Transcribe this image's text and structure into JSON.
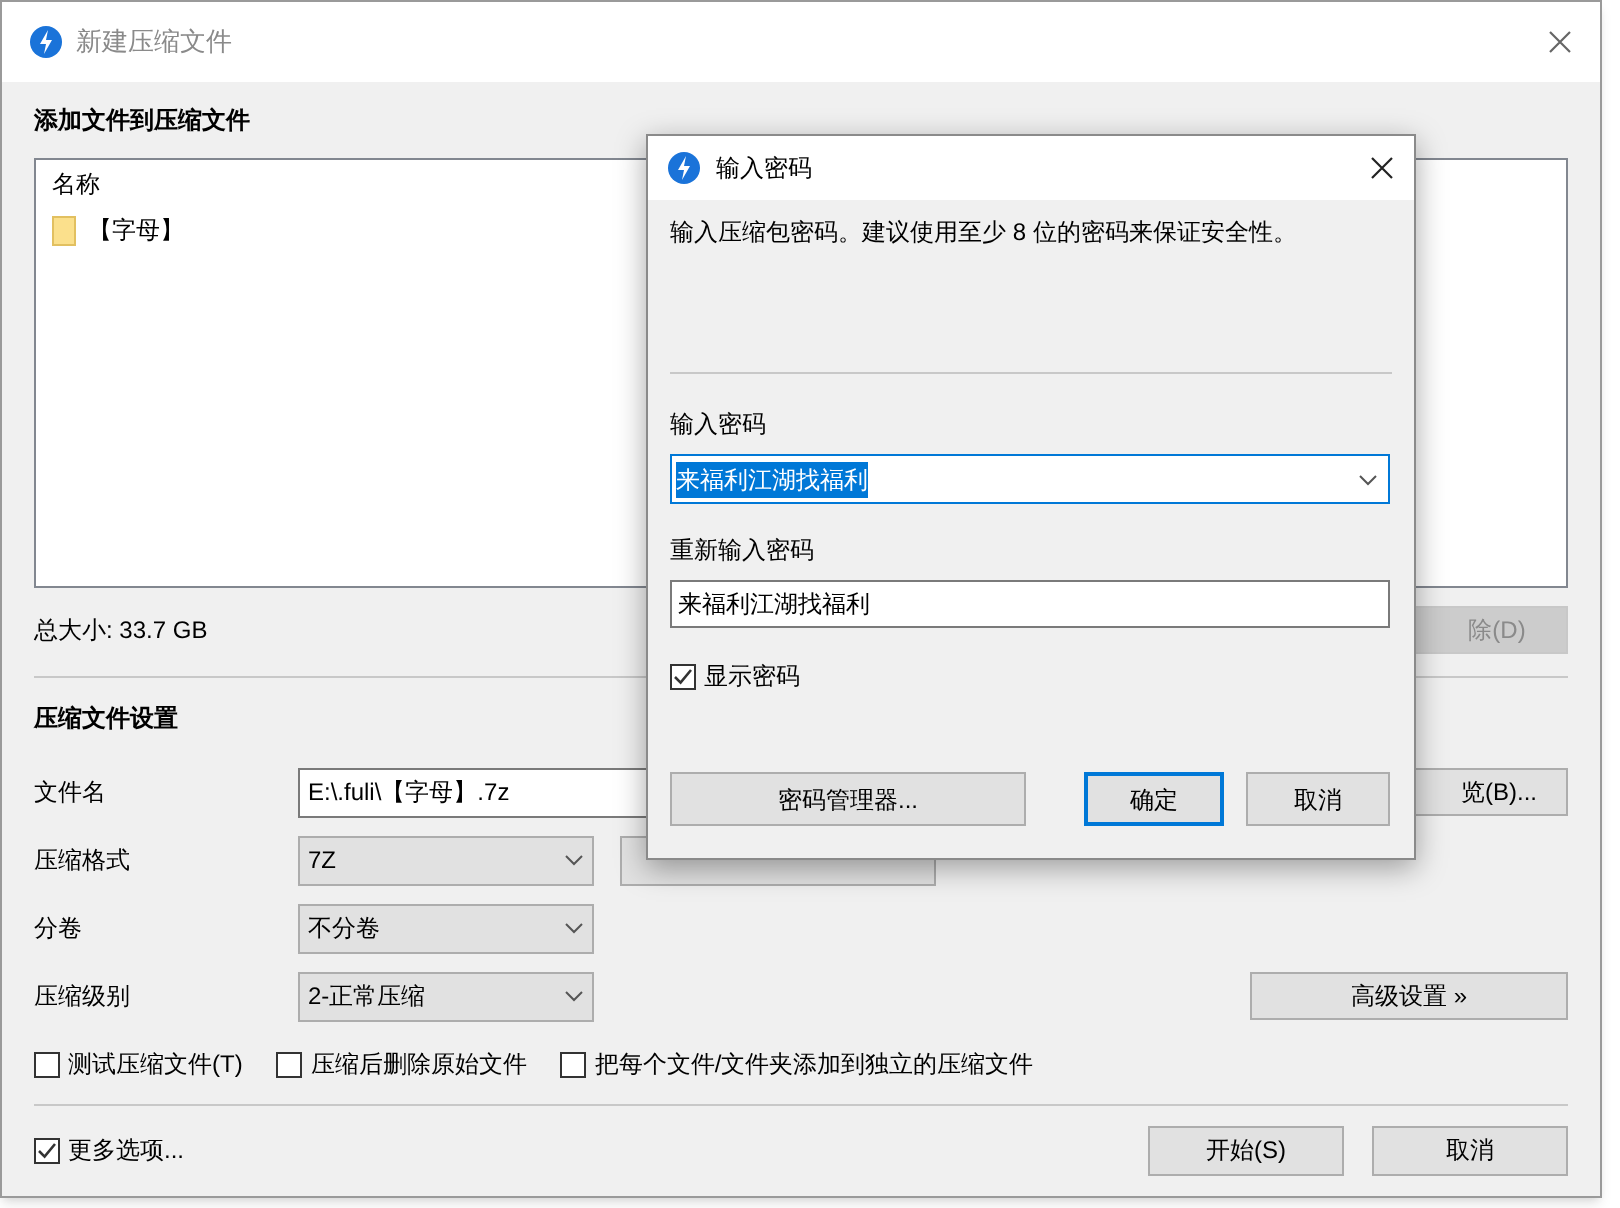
{
  "window": {
    "title": "新建压缩文件"
  },
  "files": {
    "heading": "添加文件到压缩文件",
    "column": "名称",
    "items": [
      {
        "name": "【字母】"
      }
    ],
    "total_size": "总大小: 33.7 GB",
    "delete_button": {
      "label": "除(D)",
      "disabled": true
    }
  },
  "settings": {
    "heading": "压缩文件设置",
    "filename": {
      "label": "文件名",
      "value": "E:\\.fuli\\【字母】.7z"
    },
    "browse_button": "览(B)...",
    "selects": [
      {
        "label": "压缩格式",
        "value": "7Z"
      },
      {
        "label": "分卷",
        "value": "不分卷"
      },
      {
        "label": "压缩级别",
        "value": "2-正常压缩"
      }
    ],
    "advanced_button": "高级设置 »",
    "options": [
      {
        "label": "测试压缩文件(T)",
        "checked": false
      },
      {
        "label": "压缩后删除原始文件",
        "checked": false
      },
      {
        "label": "把每个文件/文件夹添加到独立的压缩文件",
        "checked": false
      }
    ]
  },
  "footer": {
    "more_options": {
      "label": "更多选项...",
      "checked": true
    },
    "buttons": [
      "开始(S)",
      "取消"
    ]
  },
  "dialog": {
    "title": "输入密码",
    "description": "输入压缩包密码。建议使用至少 8 位的密码来保证安全性。",
    "password": {
      "label": "输入密码",
      "value": "来福利江湖找福利",
      "text_selected": true
    },
    "confirm": {
      "label": "重新输入密码",
      "value": "来福利江湖找福利"
    },
    "show_password": {
      "label": "显示密码",
      "checked": true
    },
    "buttons": [
      {
        "label": "密码管理器...",
        "default": false
      },
      {
        "label": "确定",
        "default": true
      },
      {
        "label": "取消",
        "default": false
      }
    ]
  }
}
